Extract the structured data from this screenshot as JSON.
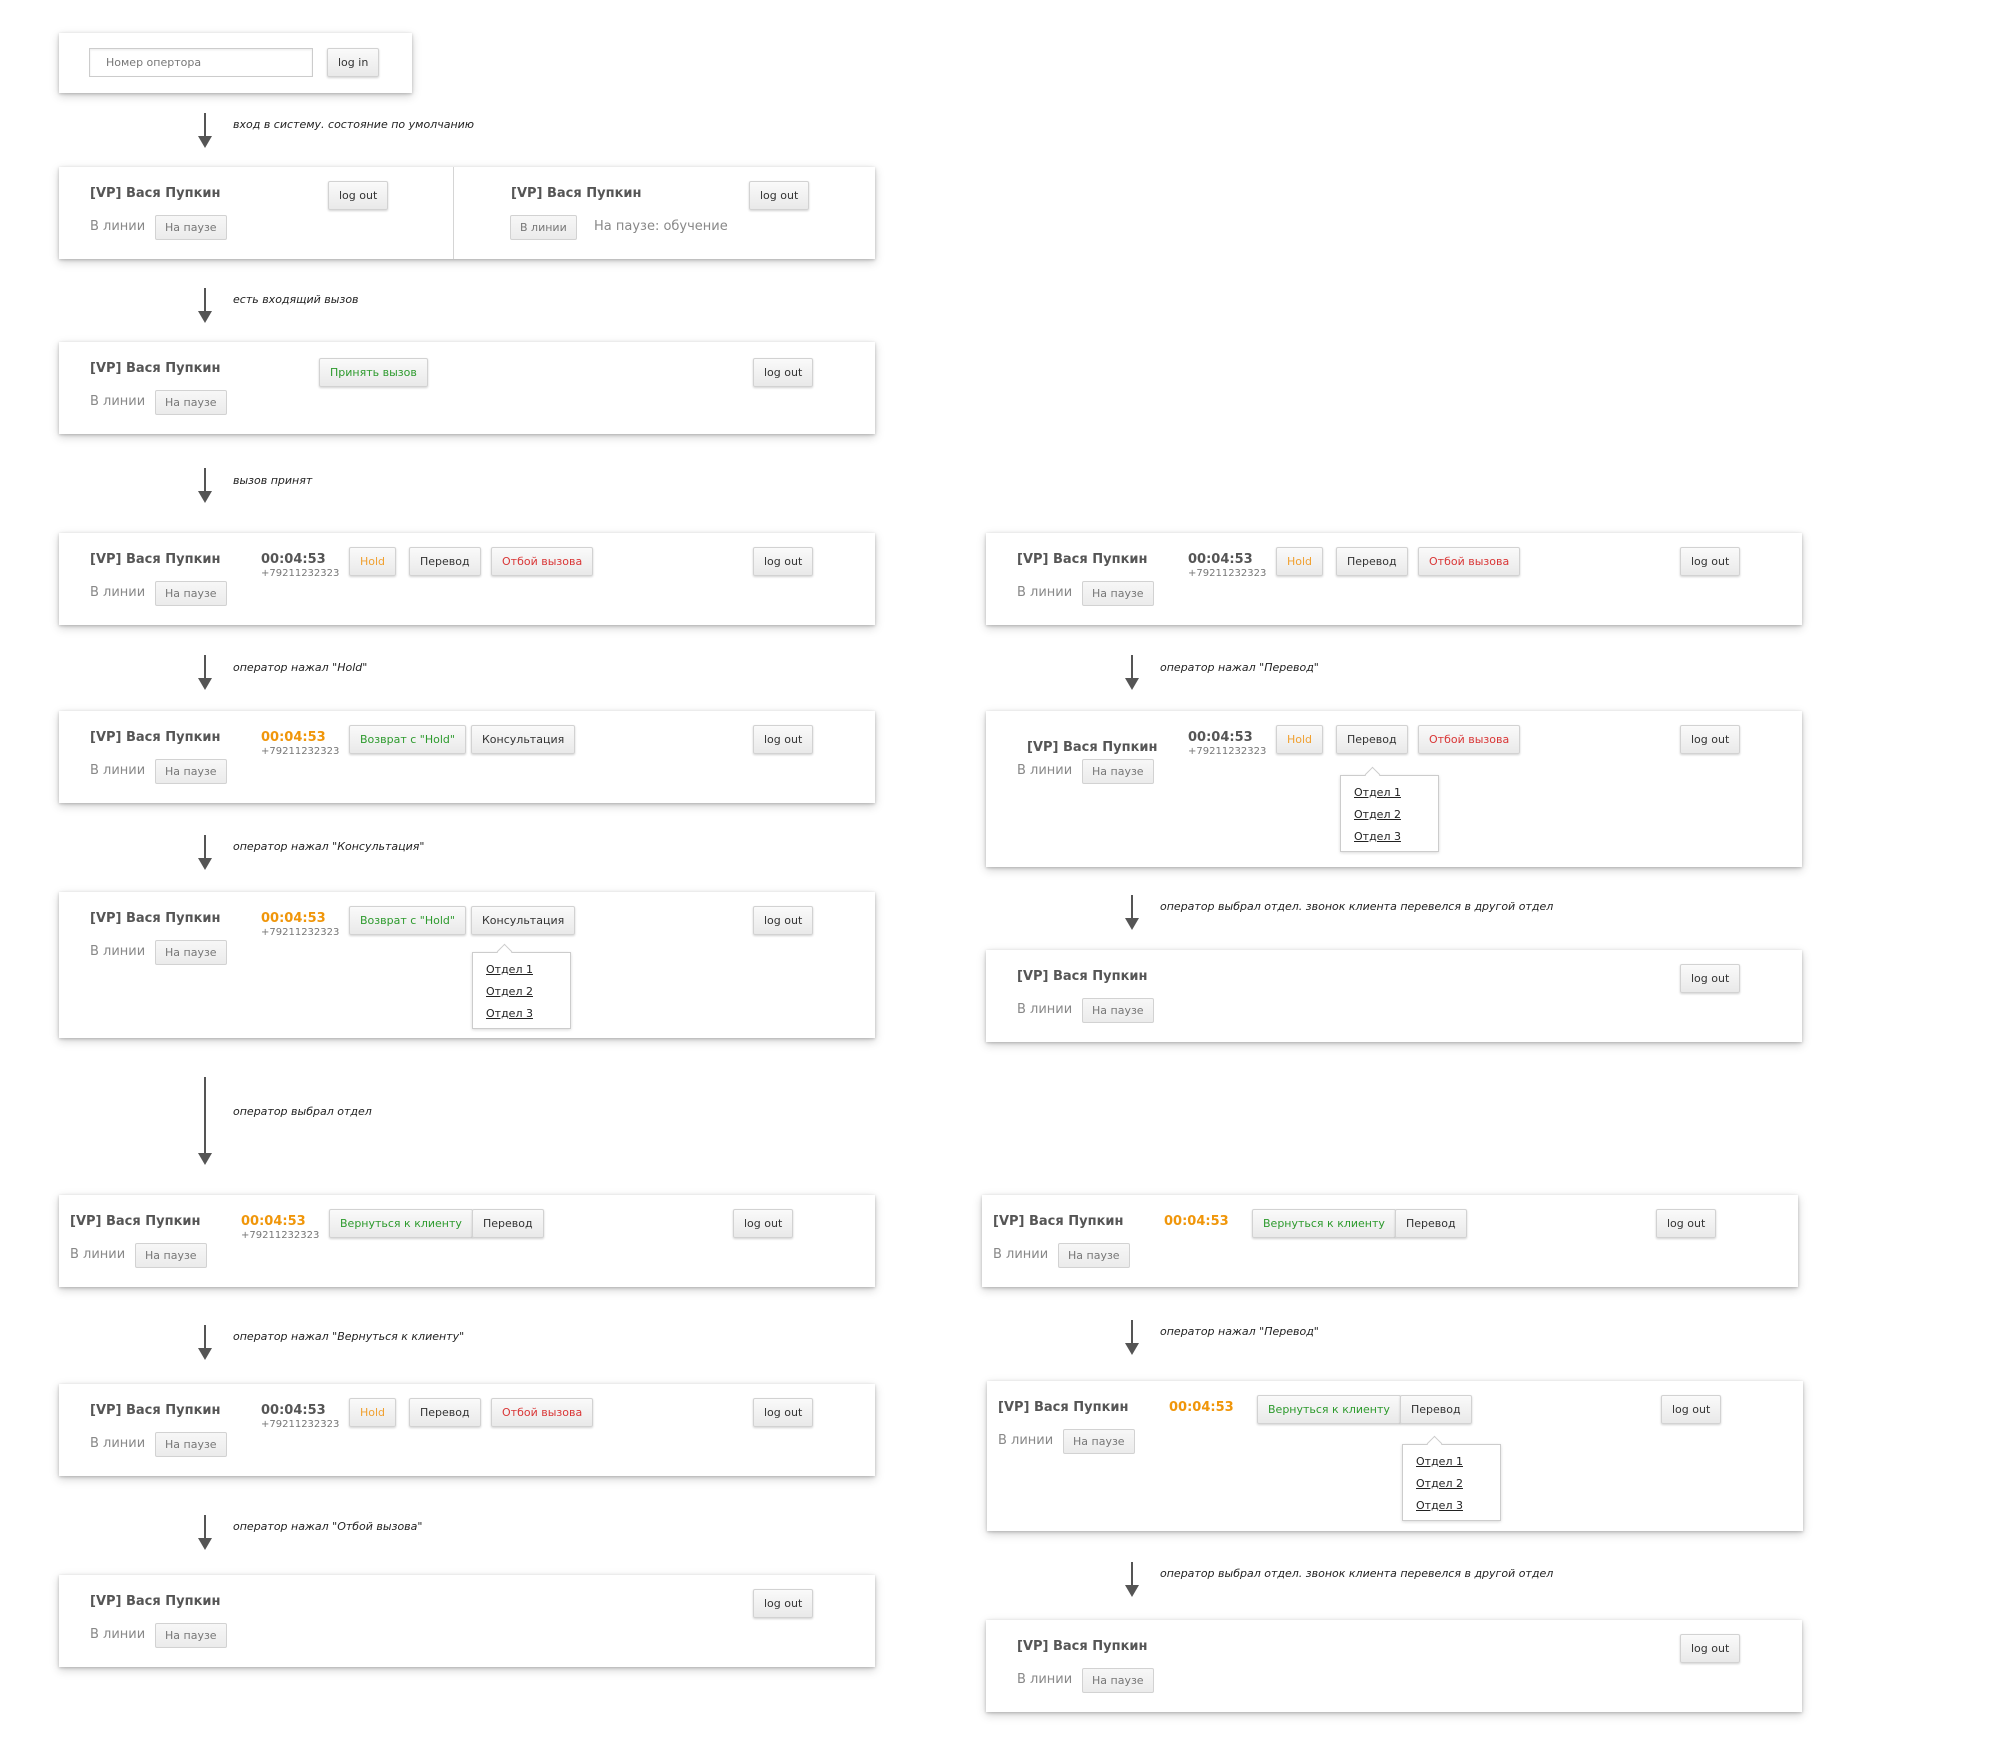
{
  "common": {
    "operator_name": "[VP] Вася Пупкин",
    "status_online": "В линии",
    "status_pause": "На паузе",
    "logout": "log out",
    "timer": "00:04:53",
    "phone": "+79211232323",
    "hold": "Hold",
    "transfer": "Перевод",
    "hangup": "Отбой вызова",
    "return_from_hold": "Возврат с \"Hold\"",
    "consult": "Консультация",
    "back_to_client": "Вернуться к клиенту",
    "accept_call": "Принять вызов",
    "pause_training": "На паузе: обучение",
    "departments": [
      "Отдел 1",
      "Отдел 2",
      "Отдел 3"
    ]
  },
  "login": {
    "placeholder": "Номер опертора",
    "button": "log in"
  },
  "notes": {
    "login": "вход в систему. состояние по умолчанию",
    "incoming": "есть входящий вызов",
    "accepted": "вызов принят",
    "hold_pressed": "оператор нажал \"Hold\"",
    "consult_pressed": "оператор нажал \"Консультация\"",
    "dept_chosen": "оператор выбрал отдел",
    "back_pressed": "оператор нажал \"Вернуться к клиенту\"",
    "hangup_pressed": "оператор нажал \"Отбой вызова\"",
    "transfer_pressed": "оператор нажал \"Перевод\"",
    "transferred": "оператор выбрал отдел. звонок клиента перевелся в другой отдел"
  }
}
